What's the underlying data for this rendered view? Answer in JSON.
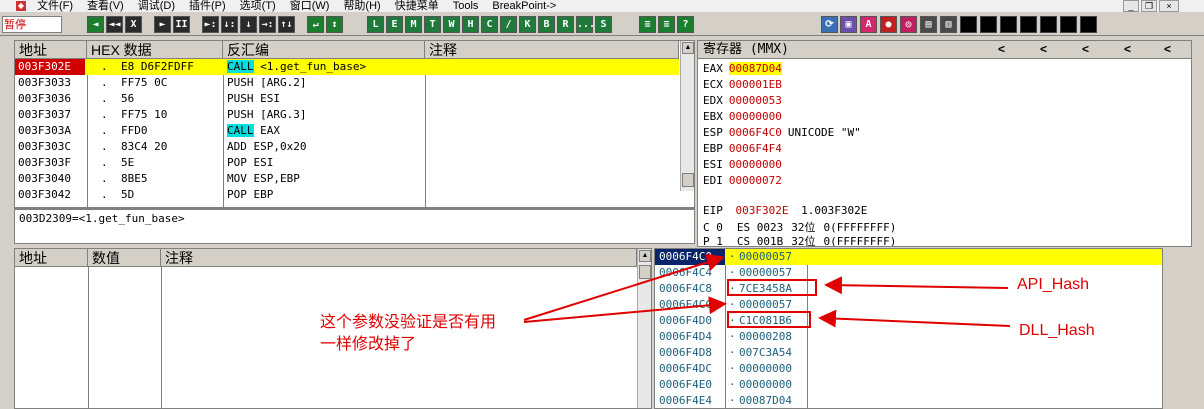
{
  "menu": {
    "items": [
      "文件(F)",
      "查看(V)",
      "调试(D)",
      "插件(P)",
      "选项(T)",
      "窗口(W)",
      "帮助(H)",
      "快捷菜单",
      "Tools",
      "BreakPoint->"
    ]
  },
  "status": "暂停",
  "toolbar": {
    "ctrl_buttons": [
      "◄◄",
      "X",
      "►",
      "II",
      "►:",
      "↓:",
      "↓",
      "→:",
      "↑↓"
    ],
    "letter_buttons": [
      "L",
      "E",
      "M",
      "T",
      "W",
      "H",
      "C",
      "/",
      "K",
      "B",
      "R",
      "...",
      "S"
    ],
    "right_buttons": [
      "≡",
      "≡",
      "?"
    ]
  },
  "disasm": {
    "headers": {
      "addr": "地址",
      "hex": "HEX 数据",
      "dis": "反汇编",
      "comment": "注释"
    },
    "rows": [
      {
        "addr": "003F302E",
        "mark": ".",
        "hex": "E8 D6F2FDFF",
        "dis": "CALL <1.get_fun_base>",
        "kw": "CALL",
        "rest": " <1.get_fun_base>"
      },
      {
        "addr": "003F3033",
        "mark": ".",
        "hex": "FF75 0C",
        "dis": "PUSH [ARG.2]"
      },
      {
        "addr": "003F3036",
        "mark": ".",
        "hex": "56",
        "dis": "PUSH ESI"
      },
      {
        "addr": "003F3037",
        "mark": ".",
        "hex": "FF75 10",
        "dis": "PUSH [ARG.3]"
      },
      {
        "addr": "003F303A",
        "mark": ".",
        "hex": "FFD0",
        "dis": "CALL EAX",
        "kw": "CALL",
        "rest": " EAX"
      },
      {
        "addr": "003F303C",
        "mark": ".",
        "hex": "83C4 20",
        "dis": "ADD ESP,0x20"
      },
      {
        "addr": "003F303F",
        "mark": ".",
        "hex": "5E",
        "dis": "POP ESI"
      },
      {
        "addr": "003F3040",
        "mark": ".",
        "hex": "8BE5",
        "dis": "MOV ESP,EBP"
      },
      {
        "addr": "003F3042",
        "mark": ".",
        "hex": "5D",
        "dis": "POP EBP"
      }
    ],
    "info": "003D2309=<1.get_fun_base>"
  },
  "registers": {
    "title": "寄存器 (MMX)",
    "nav": [
      "<",
      "<",
      "<",
      "<",
      "<"
    ],
    "rows": [
      {
        "name": "EAX",
        "value": "00087D04",
        "highlight": true
      },
      {
        "name": "ECX",
        "value": "000001EB"
      },
      {
        "name": "EDX",
        "value": "00000053"
      },
      {
        "name": "EBX",
        "value": "00000000"
      },
      {
        "name": "ESP",
        "value": "0006F4C0",
        "extra": "UNICODE \"W\""
      },
      {
        "name": "EBP",
        "value": "0006F4F4"
      },
      {
        "name": "ESI",
        "value": "00000000"
      },
      {
        "name": "EDI",
        "value": "00000072"
      }
    ],
    "eip": {
      "name": "EIP",
      "value": "003F302E",
      "extra": "1.003F302E"
    },
    "flags": [
      {
        "flag": "C 0",
        "seg": "ES 0023",
        "bits": "32位",
        "base": "0(FFFFFFFF)"
      },
      {
        "flag": "P 1",
        "seg": "CS 001B",
        "bits": "32位",
        "base": "0(FFFFFFFF)"
      }
    ]
  },
  "dump": {
    "headers": {
      "addr": "地址",
      "val": "数值",
      "comment": "注释"
    }
  },
  "stack": {
    "rows": [
      {
        "addr": "0006F4C0",
        "value": "00000057",
        "selected": true
      },
      {
        "addr": "0006F4C4",
        "value": "00000057"
      },
      {
        "addr": "0006F4C8",
        "value": "7CE3458A"
      },
      {
        "addr": "0006F4CC",
        "value": "00000057"
      },
      {
        "addr": "0006F4D0",
        "value": "C1C081B6"
      },
      {
        "addr": "0006F4D4",
        "value": "00000208"
      },
      {
        "addr": "0006F4D8",
        "value": "007C3A54"
      },
      {
        "addr": "0006F4DC",
        "value": "00000000"
      },
      {
        "addr": "0006F4E0",
        "value": "00000000"
      },
      {
        "addr": "0006F4E4",
        "value": "00087D04"
      }
    ]
  },
  "annotations": {
    "note_line1": "这个参数没验证是否有用",
    "note_line2": "一样修改掉了",
    "api_hash": "API_Hash",
    "dll_hash": "DLL_Hash"
  },
  "colors": {
    "annotation": "#e00000",
    "selection": "#ffff00",
    "keyword": "#00e0e0",
    "register_value": "#c00000"
  }
}
